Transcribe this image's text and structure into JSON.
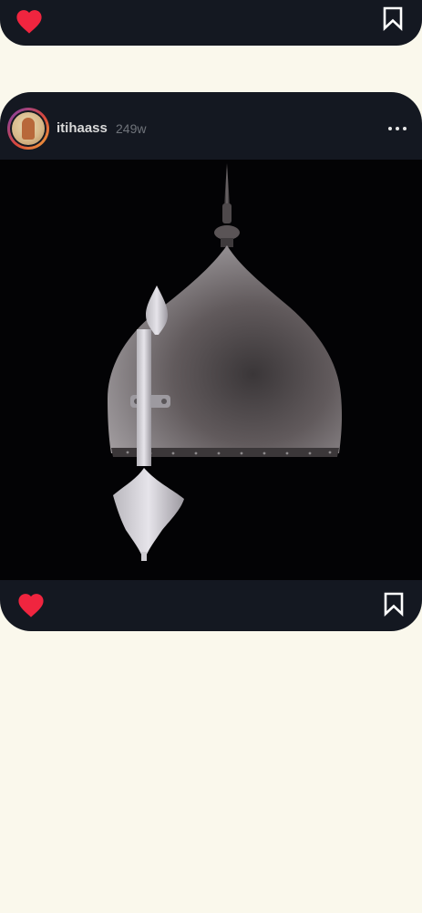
{
  "feed": {
    "previous_post": {
      "actions": {
        "like_icon": "heart-filled-icon",
        "save_icon": "bookmark-outline-icon",
        "liked": true
      }
    },
    "post": {
      "author": {
        "username": "itihaass",
        "avatar_icon": "avatar-story-ring"
      },
      "time_ago": "249w",
      "more_icon": "ellipsis-horizontal-icon",
      "image": {
        "subject": "helmet"
      },
      "actions": {
        "like_icon": "heart-filled-icon",
        "save_icon": "bookmark-outline-icon",
        "liked": true
      }
    }
  },
  "colors": {
    "page_background": "#FAF8EC",
    "card_background": "#141821",
    "like_red": "#F0253F",
    "icon_white": "#FFFFFF",
    "username_text": "#D9D9D9",
    "meta_text": "#6F737A"
  }
}
